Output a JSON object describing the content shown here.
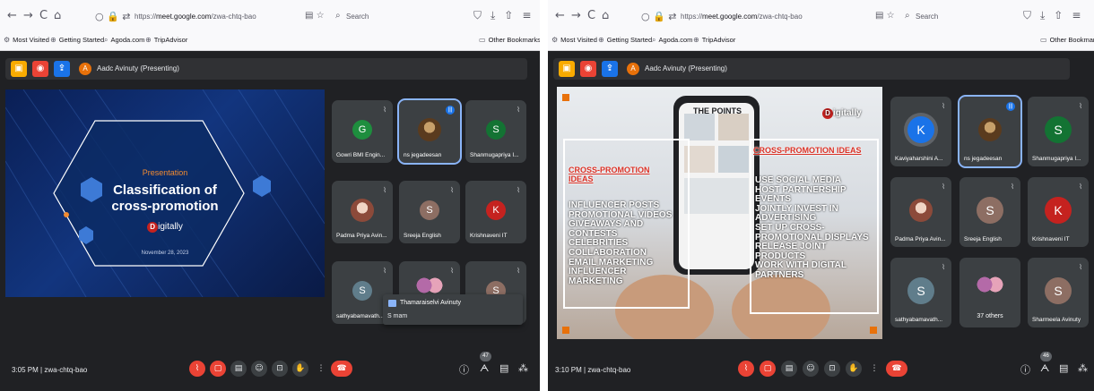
{
  "browser": {
    "nav": [
      "←",
      "→",
      "C",
      "⌂"
    ],
    "url_prefix": "https://",
    "url_host": "meet.google.com",
    "url_path": "/zwa-chtq-bao",
    "search_placeholder": "Search",
    "bookmarks": [
      "Most Visited",
      "Getting Started",
      "Agoda.com",
      "TripAdvisor"
    ],
    "other_bookmarks": "Other Bookmarks"
  },
  "left": {
    "presenter_initial": "A",
    "presenter_label": "Aadc Avinuty (Presenting)",
    "slide": {
      "kicker": "Presentation",
      "title_line1": "Classification of",
      "title_line2": "cross-promotion",
      "brand_mark": "D",
      "brand_text": "igitally",
      "date": "November 28, 2023"
    },
    "tiles": [
      {
        "initial": "G",
        "name": "Gowri BMI Engin...",
        "color": "#1e8e3e"
      },
      {
        "name": "ns jegadeesan"
      },
      {
        "initial": "S",
        "name": "Shanmugapriya I...",
        "color": "#137333"
      },
      {
        "name": "Padma Priya Avin..."
      },
      {
        "initial": "S",
        "name": "Sreeja English",
        "color": "#8d6e63"
      },
      {
        "initial": "K",
        "name": "Krishnaveni IT",
        "color": "#c5221f"
      },
      {
        "initial": "S",
        "name": "sathyabamavath...",
        "color": "#607d8b"
      },
      {
        "name": ""
      },
      {
        "initial": "S",
        "name": "",
        "color": "#8d6e63"
      }
    ],
    "toast": {
      "name": "Thamaraiselvi Avinuty",
      "message": "S mam"
    },
    "time_meeting": "3:05 PM  |  zwa-chtq-bao",
    "people_count": "47"
  },
  "right": {
    "presenter_initial": "A",
    "presenter_label": "Aadc Avinuty (Presenting)",
    "slide": {
      "heading": "THE POINTS",
      "brand_mark": "D",
      "brand_text": "igitally",
      "box1_title_line1": "CROSS-PROMOTION",
      "box1_title_line2": "IDEAS",
      "box1_items": [
        "INFLUENCER POSTS",
        "PROMOTIONAL VIDEOS",
        "GIVEAWAYS AND",
        "CONTESTS",
        "CELEBRITIES",
        "COLLABORATION",
        "EMAIL MARKETING",
        "INFLUENCER",
        "MARKETING"
      ],
      "box2_title": "CROSS-PROMOTION IDEAS",
      "box2_items": [
        "USE SOCIAL MEDIA",
        "HOST PARTNERSHIP EVENTS",
        "JOINTLY INVEST IN",
        "ADVERTISING",
        "SET UP CROSS-",
        "PROMOTIONAL DISPLAYS",
        "RELEASE JOINT PRODUCTS",
        "WORK WITH DIGITAL",
        "PARTNERS"
      ]
    },
    "tiles": [
      {
        "initial": "K",
        "name": "Kaviyaharshini A...",
        "color": "#1a73e8"
      },
      {
        "name": "ns jegadeesan"
      },
      {
        "initial": "S",
        "name": "Shanmugapriya I...",
        "color": "#137333"
      },
      {
        "name": "Padma Priya Avin..."
      },
      {
        "initial": "S",
        "name": "Sreeja English",
        "color": "#8d6e63"
      },
      {
        "initial": "K",
        "name": "Krishnaveni IT",
        "color": "#c5221f"
      },
      {
        "initial": "S",
        "name": "sathyabamavath...",
        "color": "#607d8b"
      },
      {
        "name": "",
        "others": "37 others"
      },
      {
        "initial": "S",
        "name": "Sharmeela Avinuty",
        "color": "#8d6e63"
      }
    ],
    "time_meeting": "3:10 PM  |  zwa-chtq-bao",
    "people_count": "46"
  },
  "colors": {
    "meet_bg": "#202124",
    "tile_bg": "#3c4043",
    "end_call": "#ea4335",
    "speaking": "#1a73e8"
  }
}
